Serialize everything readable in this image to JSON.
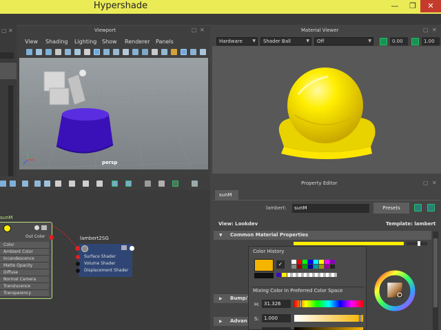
{
  "window": {
    "title": "Hypershade"
  },
  "viewport": {
    "title": "Viewport",
    "menu": [
      "View",
      "Shading",
      "Lighting",
      "Show",
      "Renderer",
      "Panels"
    ],
    "camera_label": "persp"
  },
  "material_viewer": {
    "title": "Material Viewer",
    "renderer": "Hardware",
    "geometry": "Shader Ball",
    "environment": "Off",
    "exposure": "0.00",
    "gamma": "1.00"
  },
  "node_editor": {
    "material_node": {
      "name": "sunM",
      "out_label": "Out Color",
      "attributes": [
        "Color",
        "Ambient Color",
        "Incandescence",
        "Matte Opacity",
        "Diffuse",
        "Normal Camera",
        "Translucence",
        "Transparency"
      ]
    },
    "sg_node": {
      "name": "lambert2SG",
      "attributes": [
        "Surface Shader",
        "Volume Shader",
        "Displacement Shader"
      ]
    }
  },
  "property_editor": {
    "title": "Property Editor",
    "tab": "sunM",
    "type_label": "lambert:",
    "name_value": "sunM",
    "presets_label": "Presets",
    "view_label": "View: Lookdev",
    "template_label": "Template: lambert",
    "sections": [
      "Common Material Properties",
      "Bump/",
      "Advan"
    ]
  },
  "color_picker": {
    "history_label": "Color History",
    "mixing_label": "Mixing Color in Preferred Color Space",
    "h_label": "H:",
    "h_value": "31.326",
    "s_label": "S:",
    "s_value": "1.000",
    "current_color": "#f5b400"
  },
  "colors": {
    "titlebar": "#ebeb56",
    "accent_green": "#22c26a",
    "material_yellow": "#ffee00",
    "node_highlight": "#b5e37a",
    "cylinder_blue": "#3a10b8"
  }
}
